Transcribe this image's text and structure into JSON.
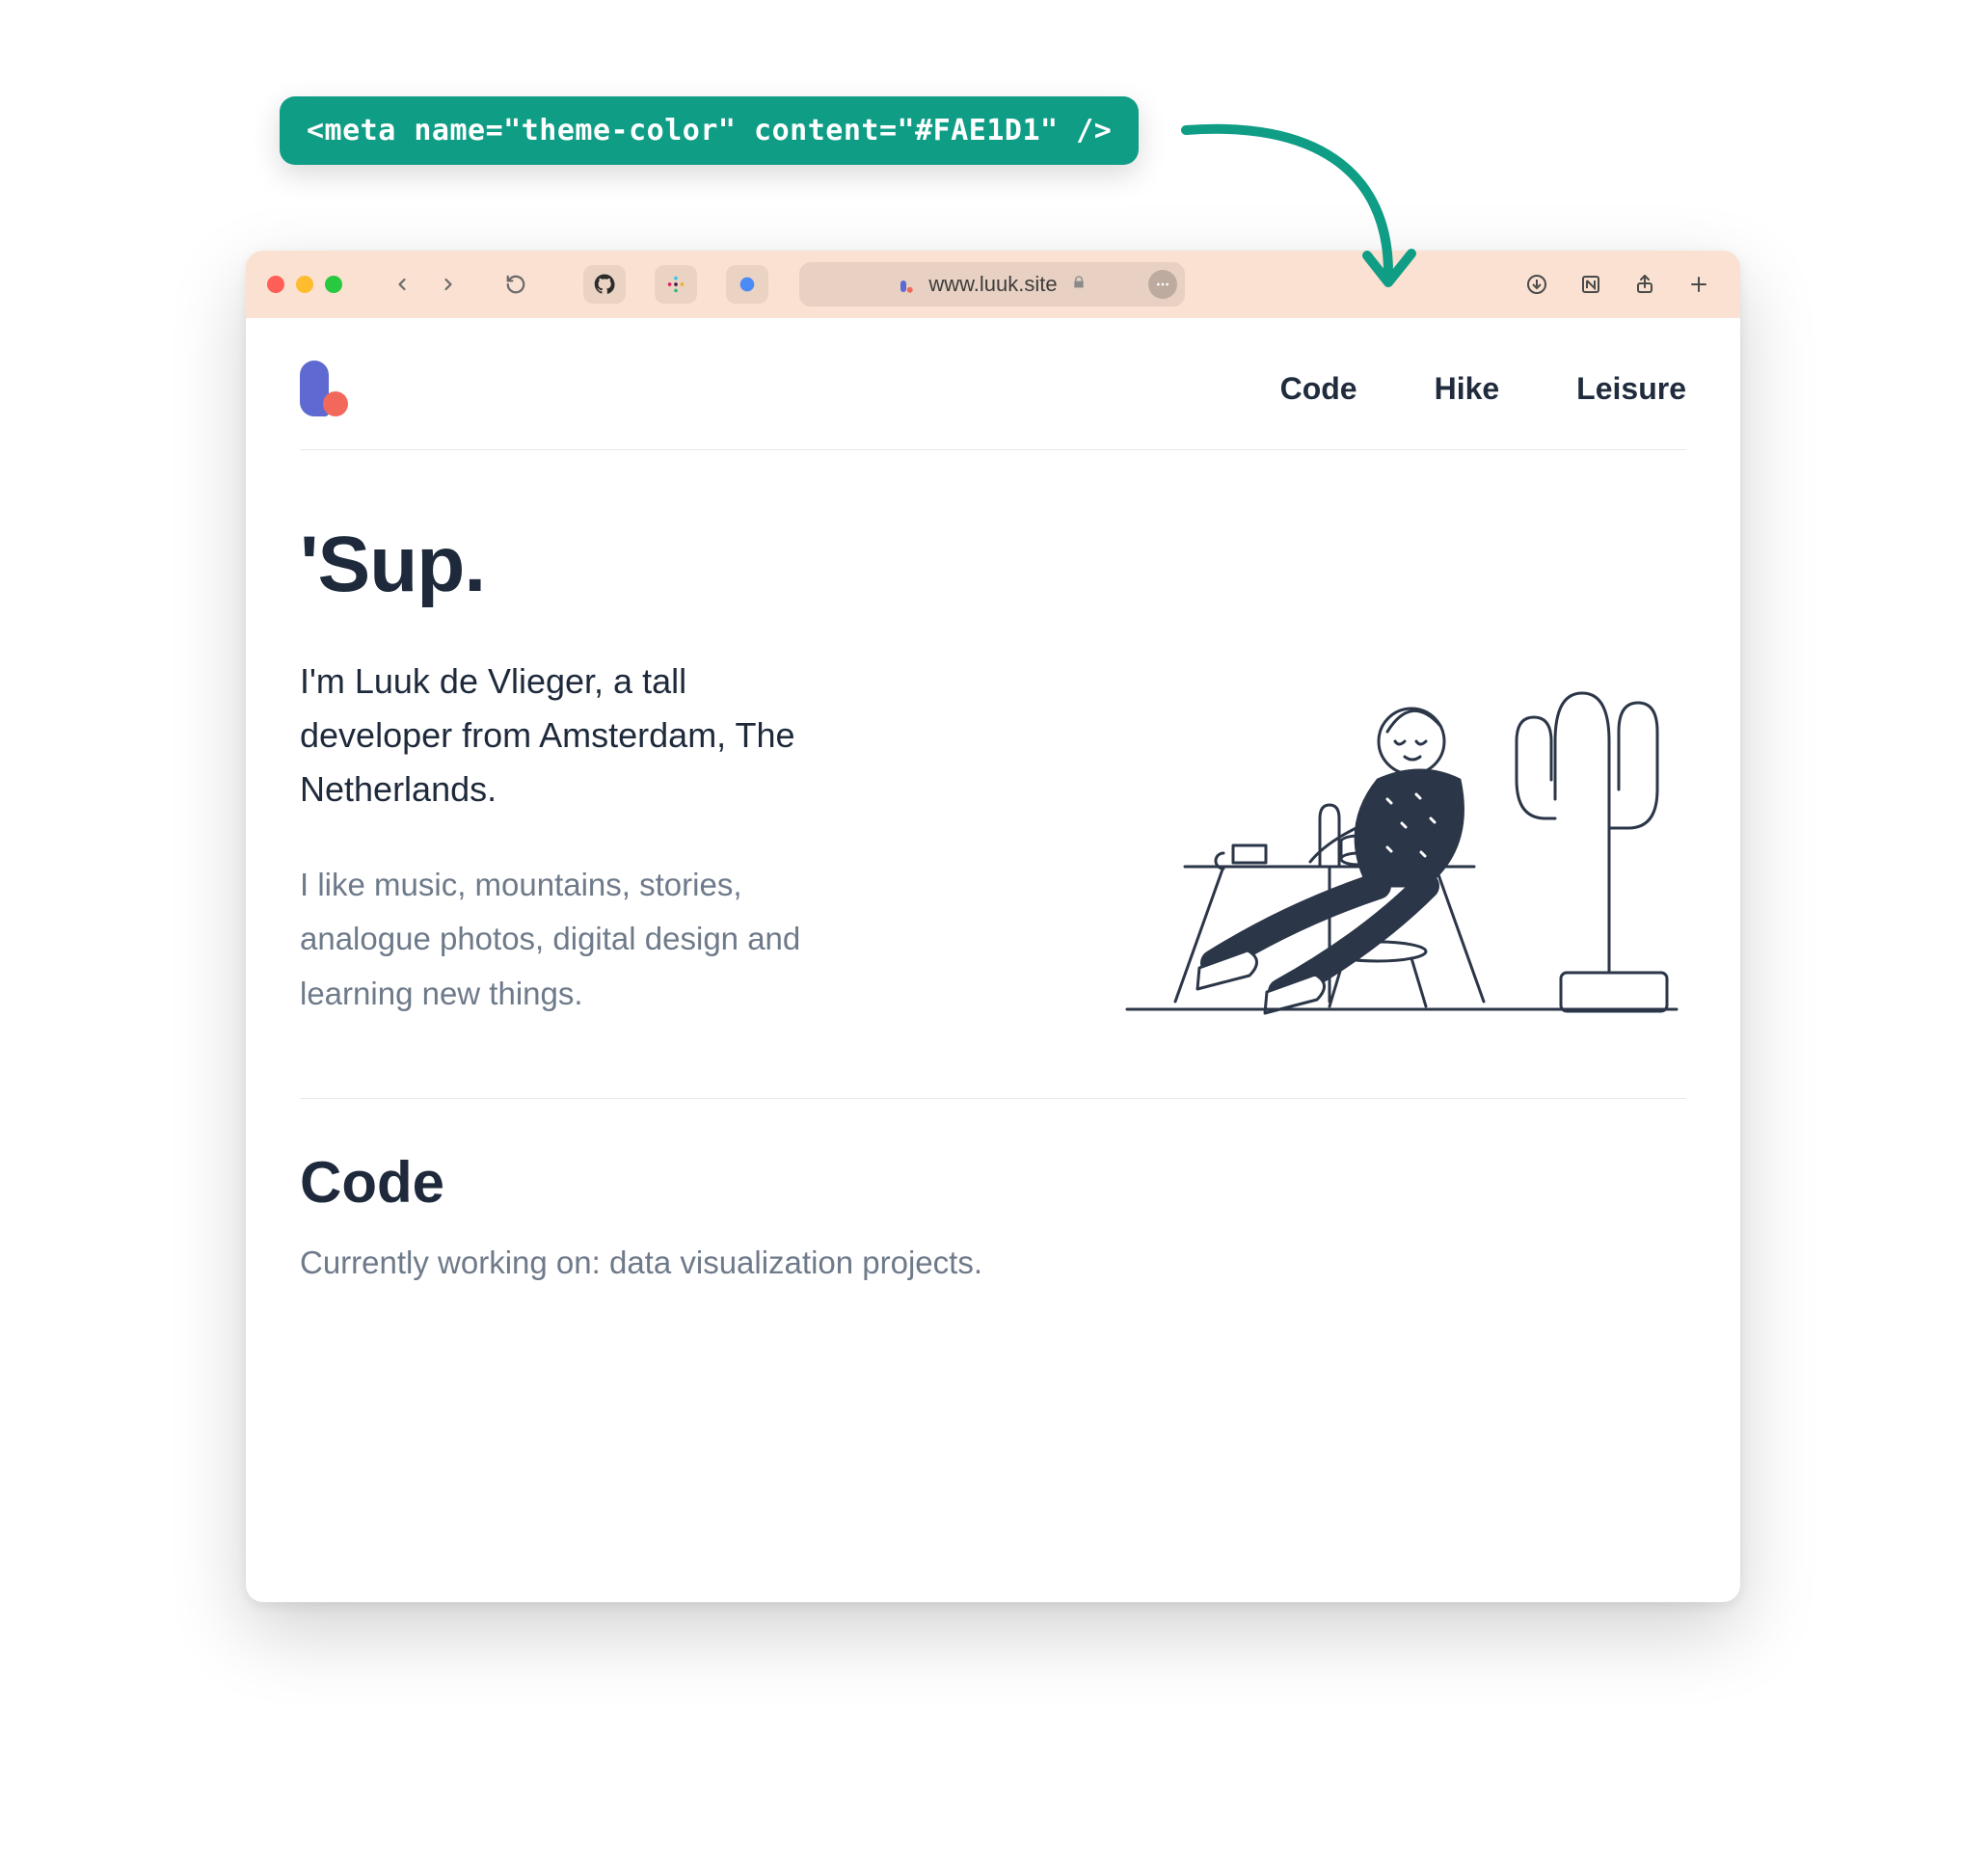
{
  "badge": {
    "text": "<meta name=\"theme-color\" content=\"#FAE1D1\" />"
  },
  "colors": {
    "theme": "#FAE1D1",
    "accent": "#0F9D86",
    "text": "#1E2A3B",
    "muted": "#6E7A8A",
    "logoBlue": "#5E6AD2",
    "logoRed": "#F2695C"
  },
  "browser": {
    "url": "www.luuk.site"
  },
  "nav": {
    "items": [
      {
        "label": "Code"
      },
      {
        "label": "Hike"
      },
      {
        "label": "Leisure"
      }
    ]
  },
  "hero": {
    "title": "'Sup.",
    "lead": "I'm Luuk de Vlieger, a tall developer from Amsterdam, The Netherlands.",
    "sub": "I like music, mountains, stories, analogue photos, digital design and learning new things."
  },
  "section_code": {
    "heading": "Code",
    "body": "Currently working on: data visualization projects."
  }
}
